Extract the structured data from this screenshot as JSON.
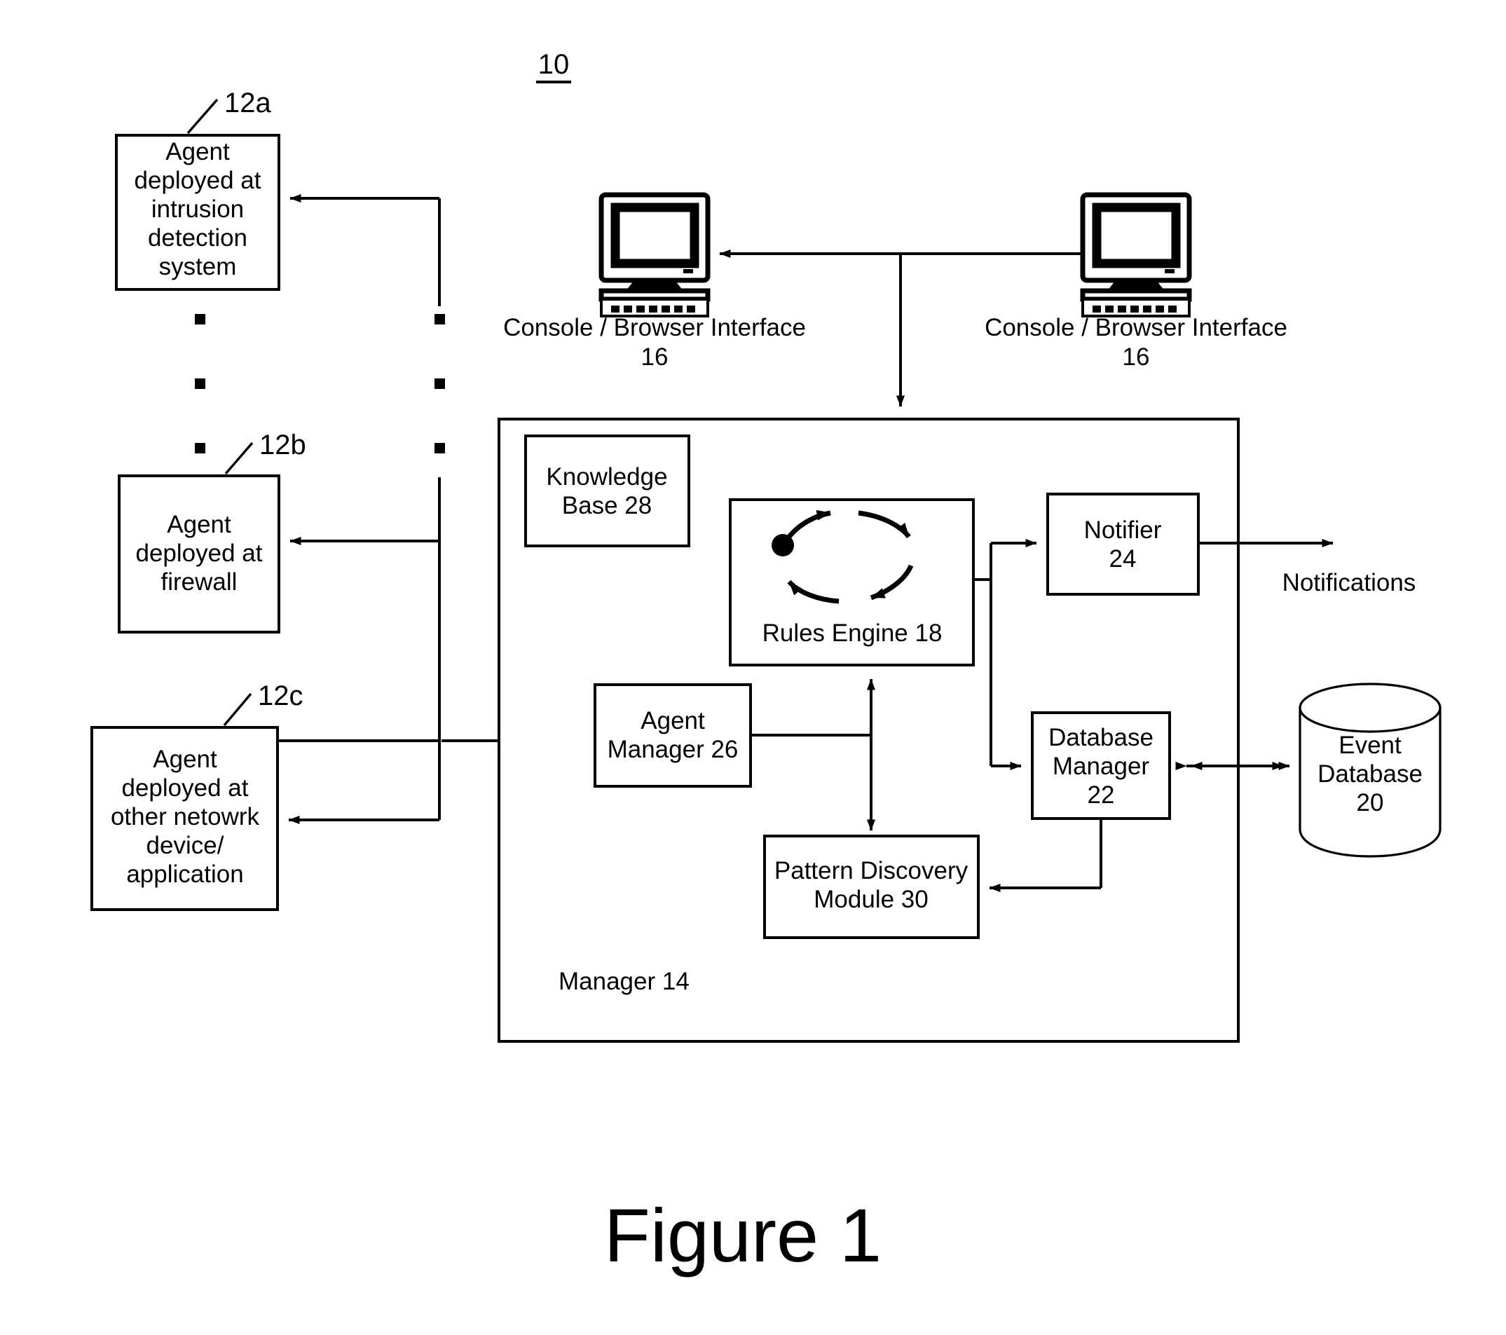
{
  "figure": {
    "caption": "Figure 1",
    "system_ref": "10"
  },
  "agents": [
    {
      "ref": "12a",
      "lines": [
        "Agent",
        "deployed at",
        "intrusion",
        "detection",
        "system"
      ]
    },
    {
      "ref": "12b",
      "lines": [
        "Agent",
        "deployed at",
        "firewall"
      ]
    },
    {
      "ref": "12c",
      "lines": [
        "Agent",
        "deployed at",
        "other netowrk",
        "device/",
        "application"
      ]
    }
  ],
  "consoles": [
    {
      "label": "Console / Browser Interface",
      "ref": "16",
      "icon": "computer-monitor-icon"
    },
    {
      "label": "Console / Browser Interface",
      "ref": "16",
      "icon": "computer-monitor-icon"
    }
  ],
  "manager": {
    "label": "Manager 14",
    "components": {
      "knowledge_base": {
        "lines": [
          "Knowledge",
          "Base 28"
        ]
      },
      "rules_engine": {
        "label": "Rules Engine 18",
        "icon": "cycle-arrows-icon"
      },
      "agent_manager": {
        "lines": [
          "Agent",
          "Manager 26"
        ]
      },
      "notifier": {
        "lines": [
          "Notifier",
          "24"
        ]
      },
      "database_manager": {
        "lines": [
          "Database",
          "Manager",
          "22"
        ]
      },
      "pattern_discovery": {
        "lines": [
          "Pattern Discovery",
          "Module 30"
        ]
      }
    }
  },
  "external": {
    "event_database": {
      "lines": [
        "Event",
        "Database",
        "20"
      ],
      "shape": "cylinder"
    },
    "notifications_label": "Notifications"
  },
  "colors": {
    "stroke": "#000000",
    "fill": "#ffffff",
    "background": "#ffffff"
  }
}
